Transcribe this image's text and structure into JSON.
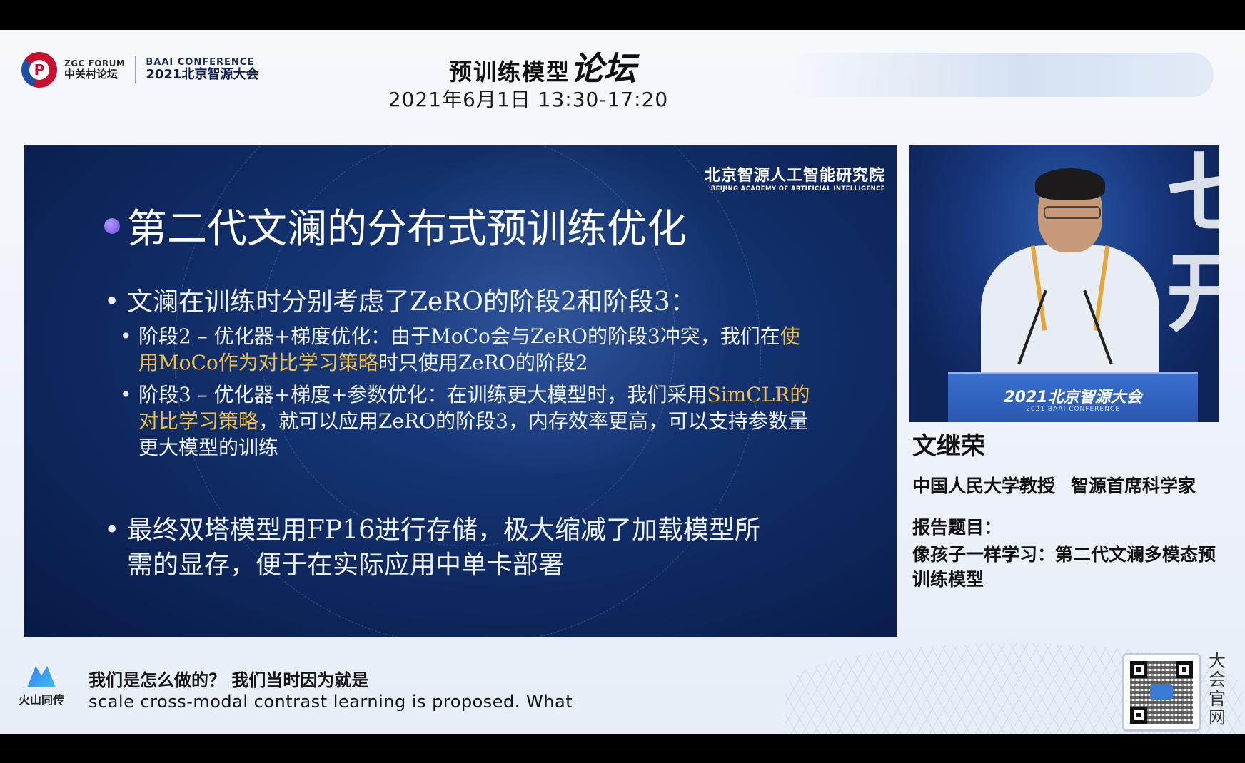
{
  "header": {
    "zgc_logo_en": "ZGC FORUM",
    "zgc_logo_cn": "中关村论坛",
    "baai_logo_en": "BAAI CONFERENCE",
    "baai_logo_cn": "2021北京智源大会",
    "forum_title_part1": "预训练模型",
    "forum_title_part2": "论坛",
    "forum_date": "2021年6月1日   13:30-17:20"
  },
  "slide": {
    "institute_cn": "北京智源人工智能研究院",
    "institute_en": "BEIJING ACADEMY OF ARTIFICIAL INTELLIGENCE",
    "title": "第二代文澜的分布式预训练优化",
    "bullet1": "文澜在训练时分别考虑了ZeRO的阶段2和阶段3：",
    "sub1": {
      "prefix": "阶段2 – 优化器+梯度优化：由于MoCo会与ZeRO的阶段3冲突，我们在",
      "highlight": "使用MoCo作为对比学习策略",
      "suffix": "时只使用ZeRO的阶段2"
    },
    "sub2": {
      "prefix": "阶段3 – 优化器+梯度+参数优化：在训练更大模型时，我们采用",
      "highlight": "SimCLR的对比学习策略",
      "suffix": "，就可以应用ZeRO的阶段3，内存效率更高，可以支持参数量更大模型的训练"
    },
    "bullet2": "最终双塔模型用FP16进行存储，极大缩减了加载模型所需的显存，便于在实际应用中单卡部署"
  },
  "speaker": {
    "podium_text": "2021北京智源大会",
    "podium_sub": "2021 BAAI CONFERENCE",
    "name": "文继荣",
    "role1": "中国人民大学教授",
    "role2": "智源首席科学家",
    "talk_label": "报告题目：",
    "talk_title": "像孩子一样学习：第二代文澜多模态预训练模型"
  },
  "subtitle": {
    "provider": "火山同传",
    "cn": "我们是怎么做的？ 我们当时因为就是",
    "en": "scale cross-modal contrast learning is proposed. What"
  },
  "qr": {
    "label": "大会官网"
  },
  "icons": {
    "slide_bullet": "purple-orb-icon",
    "provider": "volcano-icon",
    "qr": "qr-code-icon"
  },
  "colors": {
    "slide_bg": "#12306c",
    "highlight": "#f0c14a",
    "bullet": "#7a5ce0"
  }
}
